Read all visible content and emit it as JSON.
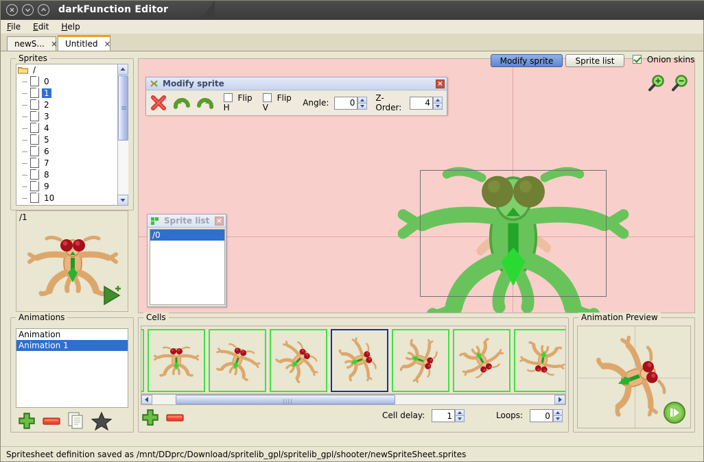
{
  "window": {
    "title": "darkFunction Editor",
    "controls": [
      {
        "name": "close-button",
        "icon": "close-circle-icon"
      },
      {
        "name": "minimize-button",
        "icon": "chevron-down-circle-icon"
      },
      {
        "name": "maximize-button",
        "icon": "chevron-up-circle-icon"
      }
    ]
  },
  "menubar": {
    "items": [
      {
        "label": "File",
        "mnemonic": "F"
      },
      {
        "label": "Edit",
        "mnemonic": "E"
      },
      {
        "label": "Help",
        "mnemonic": "H"
      }
    ]
  },
  "tabs": [
    {
      "label": "newS...",
      "close": "×",
      "active": false
    },
    {
      "label": "Untitled",
      "close": "×",
      "active": true
    }
  ],
  "sprites_panel": {
    "title": "Sprites",
    "root": "/",
    "nodes": [
      "0",
      "1",
      "2",
      "3",
      "4",
      "5",
      "6",
      "7",
      "8",
      "9",
      "10"
    ],
    "selected": "1"
  },
  "sprite_preview": {
    "path_label": "/1",
    "add_button_name": "add-sprite-to-cell-button"
  },
  "toolbar": {
    "modify_sprite_label": "Modify sprite",
    "sprite_list_label": "Sprite list",
    "onion_skins_label": "Onion skins",
    "onion_skins_checked": true,
    "modify_sprite_pressed": true,
    "zoom_in_name": "zoom-in-button",
    "zoom_out_name": "zoom-out-button"
  },
  "modify_sprite_dialog": {
    "title": "Modify sprite",
    "close_label": "×",
    "buttons": [
      {
        "name": "delete-sprite-button",
        "icon": "red-x-icon"
      },
      {
        "name": "rotate-cw-button",
        "icon": "rotate-clockwise-icon"
      },
      {
        "name": "rotate-ccw-button",
        "icon": "rotate-counterclockwise-icon"
      }
    ],
    "flip_h_label": "Flip H",
    "flip_h_checked": false,
    "flip_v_label": "Flip V",
    "flip_v_checked": false,
    "angle_label": "Angle:",
    "angle_value": "0",
    "zorder_label": "Z-Order:",
    "zorder_value": "4"
  },
  "sprite_list_dialog": {
    "title": "Sprite list",
    "close_label": "×",
    "items": [
      {
        "label": "/0",
        "selected": true
      }
    ]
  },
  "animations_panel": {
    "title": "Animations",
    "items": [
      {
        "label": "Animation",
        "selected": false
      },
      {
        "label": "Animation 1",
        "selected": true
      }
    ],
    "buttons": [
      {
        "name": "add-animation-button",
        "icon": "green-plus-icon"
      },
      {
        "name": "remove-animation-button",
        "icon": "red-minus-icon"
      },
      {
        "name": "duplicate-animation-button",
        "icon": "copy-pages-icon"
      },
      {
        "name": "set-default-animation-button",
        "icon": "star-icon"
      }
    ]
  },
  "cells_panel": {
    "title": "Cells",
    "cells": [
      {
        "index": 0,
        "selected": false,
        "angle": 0,
        "partial": true
      },
      {
        "index": 1,
        "selected": false,
        "angle": 0
      },
      {
        "index": 2,
        "selected": false,
        "angle": 20
      },
      {
        "index": 3,
        "selected": false,
        "angle": 45
      },
      {
        "index": 4,
        "selected": true,
        "angle": 70
      },
      {
        "index": 5,
        "selected": false,
        "angle": 110
      },
      {
        "index": 6,
        "selected": false,
        "angle": 150
      },
      {
        "index": 7,
        "selected": false,
        "angle": 190
      }
    ],
    "buttons": [
      {
        "name": "add-cell-button",
        "icon": "green-plus-icon"
      },
      {
        "name": "remove-cell-button",
        "icon": "red-minus-icon"
      }
    ],
    "cell_delay_label": "Cell delay:",
    "cell_delay_value": "1",
    "loops_label": "Loops:",
    "loops_value": "0"
  },
  "animation_preview": {
    "title": "Animation Preview",
    "play_button_name": "play-animation-button"
  },
  "statusbar": {
    "message": "Spritesheet definition saved as /mnt/DDprc/Download/spritelib_gpl/spritelib_gpl/shooter/newSpriteSheet.sprites"
  },
  "colors": {
    "canvas_background": "#f9cfcb",
    "panel_background": "#e9e6d2",
    "selection_blue": "#2f6fce",
    "cell_border_green": "#43e043",
    "cell_border_selected": "#1b2f9b",
    "tab_accent": "#ef9f18",
    "titlebar": "#3c3c3c"
  }
}
